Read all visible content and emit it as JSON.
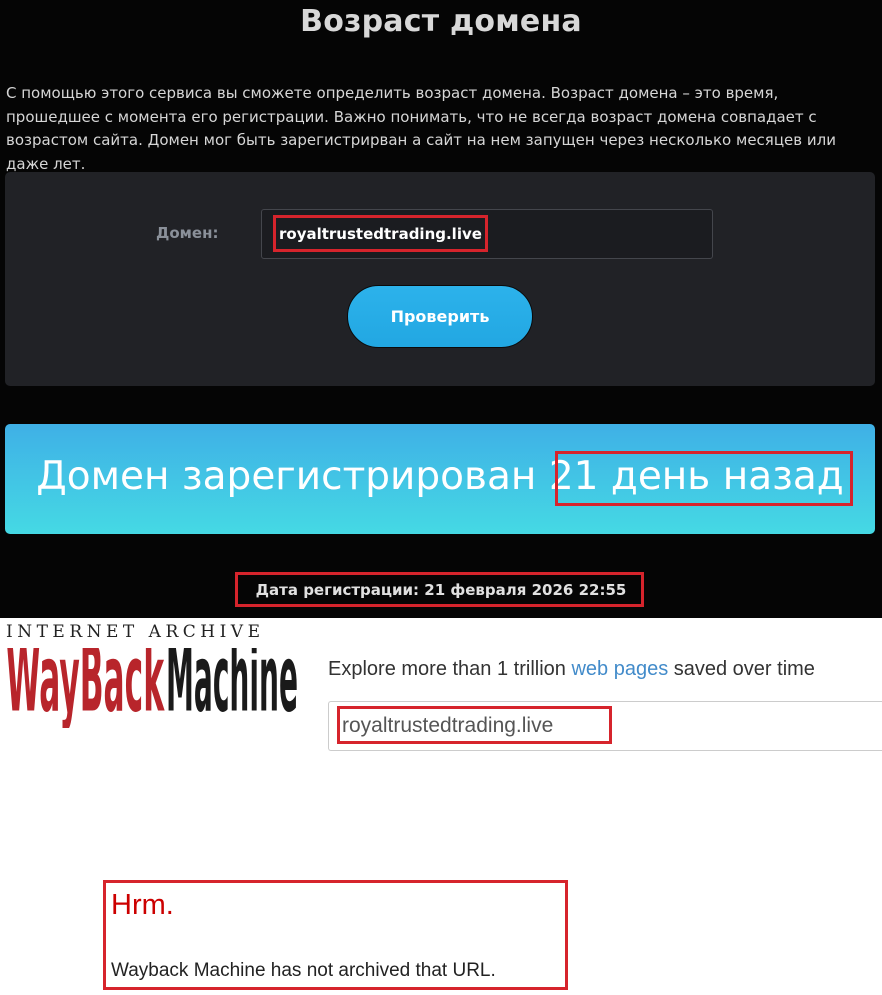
{
  "domain_checker": {
    "title": "Возраст домена",
    "intro": "С помощью этого сервиса вы сможете определить возраст домена. Возраст домена – это время, прошедшее с момента его регистрации. Важно понимать, что не всегда возраст домена совпадает с возрастом сайта. Домен мог быть зарегистрирван а сайт на нем запущен через несколько месяцев или даже лет.",
    "form": {
      "domain_label": "Домен:",
      "domain_value": "royaltrustedtrading.live",
      "check_button": "Проверить"
    },
    "result": {
      "prefix": "Домен зарегистрирован",
      "age": "21 день назад"
    },
    "registration_date": "Дата регистрации: 21 февраля 2026 22:55",
    "colors": {
      "background": "#050505",
      "panel": "#212226",
      "button": "#22a7e2",
      "banner_start": "#3fb0e6",
      "banner_end": "#45d9e4"
    }
  },
  "wayback": {
    "header_title": "INTERNET ARCHIVE",
    "logo": {
      "wayback": "WayBack",
      "machine": "Machine"
    },
    "tagline": {
      "before": "Explore more than 1 trillion ",
      "link": "web pages",
      "after": " saved over time"
    },
    "search_value": "royaltrustedtrading.live",
    "error": {
      "title": "Hrm.",
      "message": "Wayback Machine has not archived that URL."
    },
    "colors": {
      "logo_red": "#b8252b",
      "logo_black": "#1a1a1a",
      "link": "#428bca",
      "error_red": "#cc0000"
    }
  },
  "annotation_color": "#d6242c"
}
